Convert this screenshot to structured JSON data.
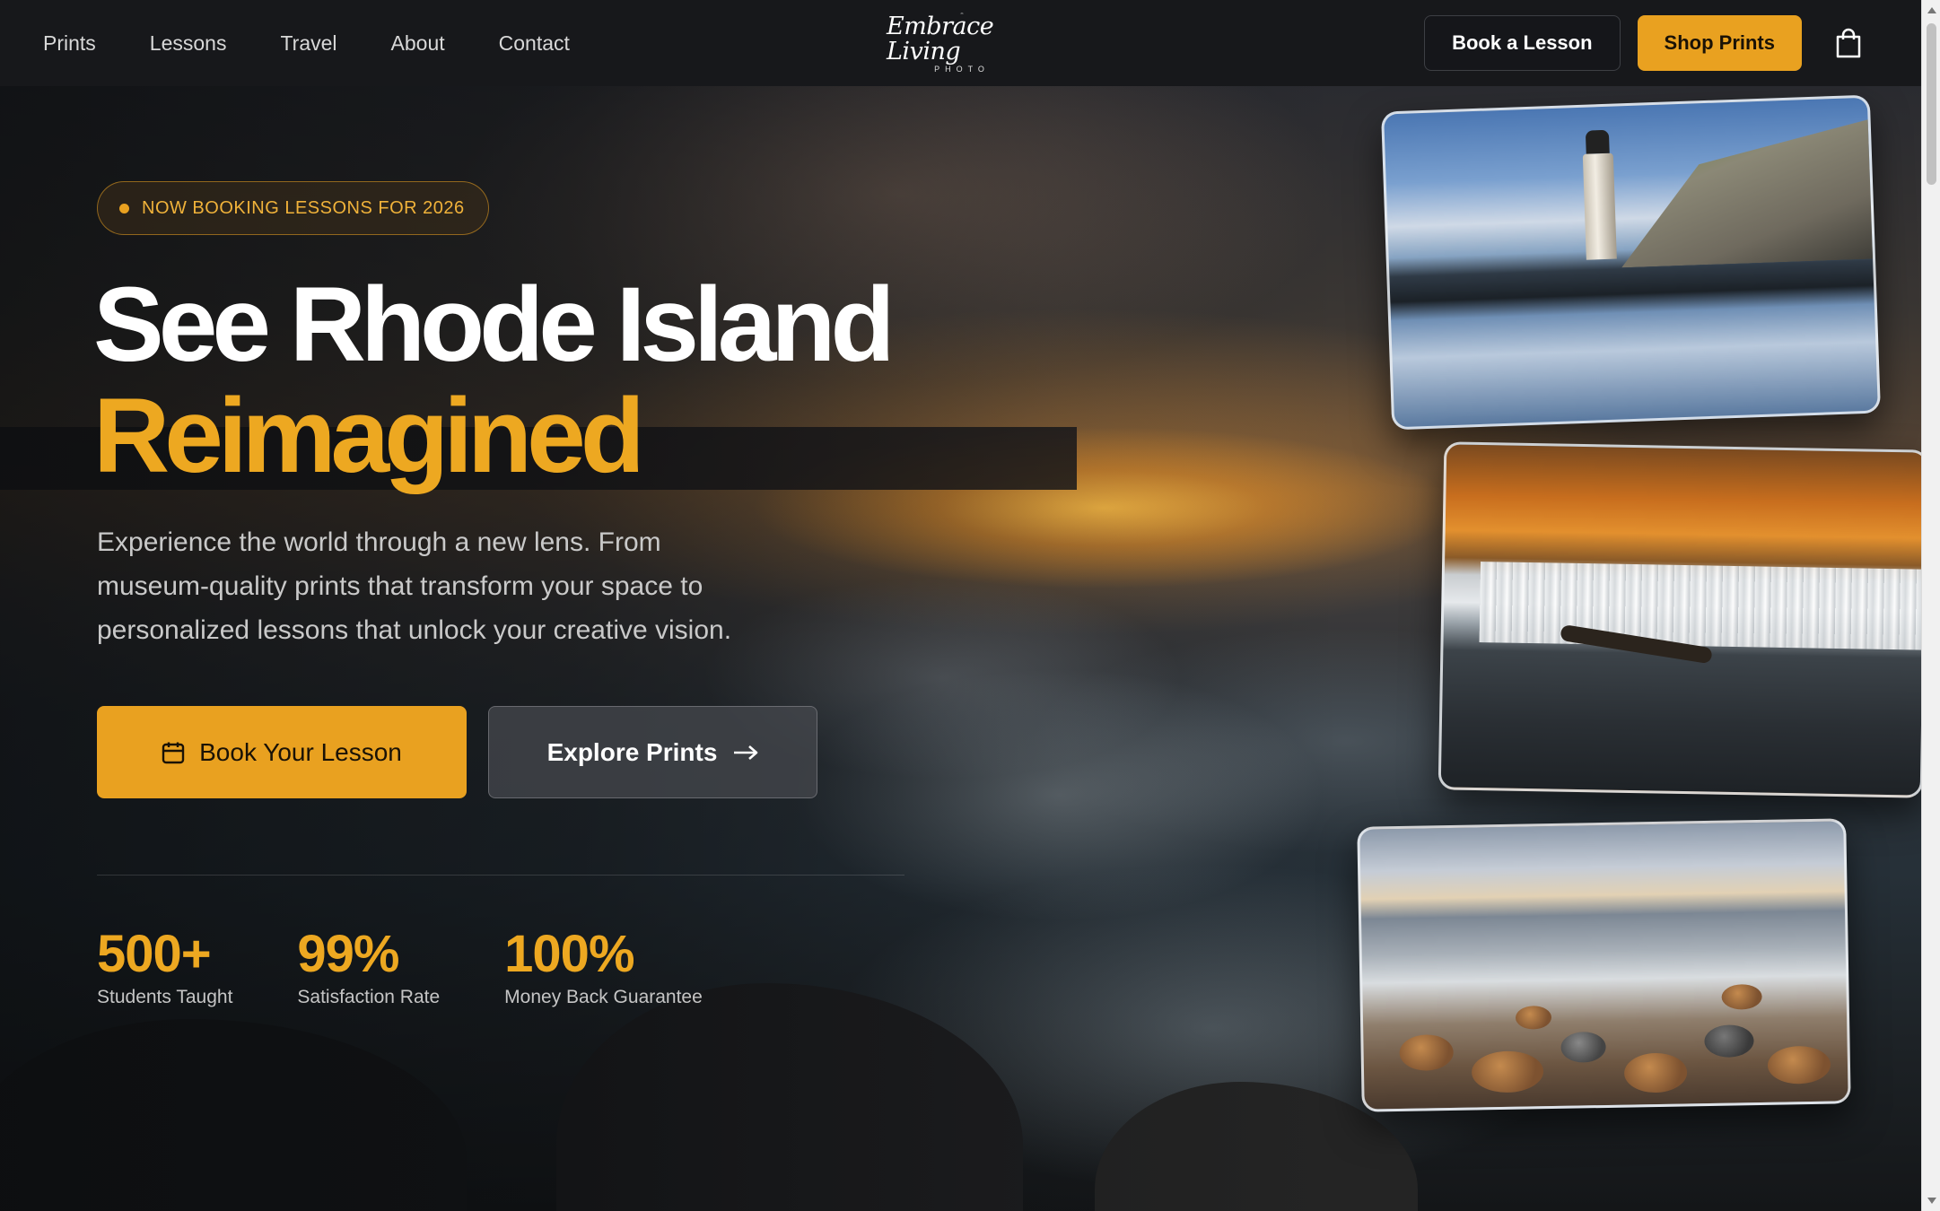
{
  "nav": {
    "links": [
      "Prints",
      "Lessons",
      "Travel",
      "About",
      "Contact"
    ],
    "logo_script": "Embrace Living",
    "logo_sub": "PHOTO",
    "book_lesson": "Book a Lesson",
    "shop_prints": "Shop Prints",
    "cart_icon": "shopping-bag-icon"
  },
  "hero": {
    "badge": "NOW BOOKING LESSONS FOR 2026",
    "headline_line1": "See Rhode Island",
    "headline_line2": "Reimagined",
    "lede": "Experience the world through a new lens. From museum-quality prints that transform your space to personalized lessons that unlock your creative vision.",
    "cta_primary": "Book Your Lesson",
    "cta_primary_icon": "calendar-icon",
    "cta_secondary": "Explore Prints",
    "cta_secondary_icon": "arrow-right-icon"
  },
  "stats": [
    {
      "value": "500+",
      "label": "Students Taught"
    },
    {
      "value": "99%",
      "label": "Satisfaction Rate"
    },
    {
      "value": "100%",
      "label": "Money Back Guarantee"
    }
  ],
  "photos": [
    {
      "subject": "lighthouse-reflection"
    },
    {
      "subject": "autumn-waterfall"
    },
    {
      "subject": "rocky-shoreline"
    }
  ],
  "colors": {
    "accent": "#e9a120",
    "headline_accent": "#eda821",
    "nav_bg": "#17181b"
  }
}
